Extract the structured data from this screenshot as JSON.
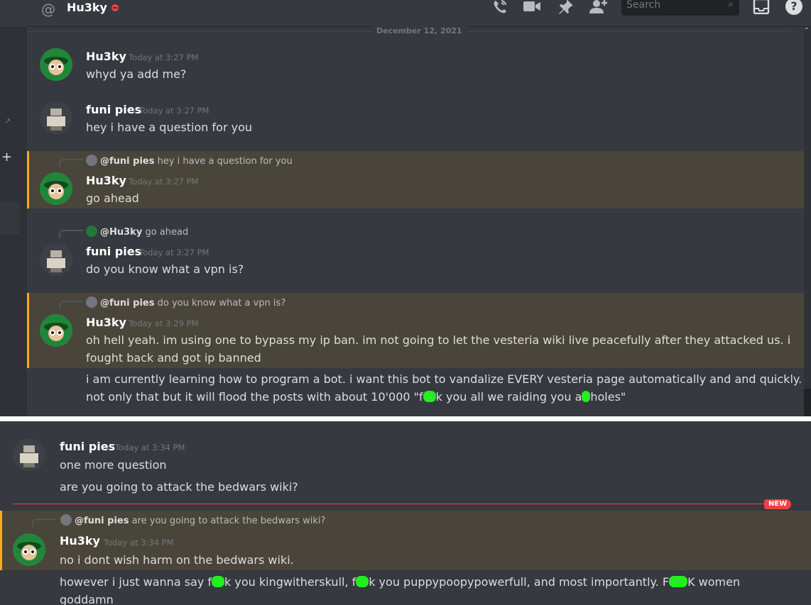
{
  "header": {
    "title": "Hu3ky",
    "search_placeholder": "Search"
  },
  "date_divider": "December 12, 2021",
  "messages": [
    {
      "author": "Hu3ky",
      "time": "Today at 3:27 PM",
      "text": "whyd ya add me?"
    },
    {
      "author": "funi pies",
      "time": "Today at 3:27 PM",
      "text": "hey i have a question for you"
    },
    {
      "reply_to": "@funi pies",
      "reply_text": "hey i have a question for you",
      "author": "Hu3ky",
      "time": "Today at 3:27 PM",
      "text": "go ahead"
    },
    {
      "reply_to": "@Hu3ky",
      "reply_text": "go ahead",
      "author": "funi pies",
      "time": "Today at 3:27 PM",
      "text": "do you know what a vpn is?"
    },
    {
      "reply_to": "@funi pies",
      "reply_text": "do you know what a vpn is?",
      "author": "Hu3ky",
      "time": "Today at 3:29 PM",
      "text_line1": "oh hell yeah. im using one to bypass my ip ban. im not going to let the vesteria wiki live peacefully after they attacked us. i",
      "text_line2": "fought back and got ip banned"
    },
    {
      "text_line1": "i am currently learning how to program a bot. i want this bot to vandalize EVERY vesteria page automatically and and quickly.",
      "text_line2_a": "not only that but it will flood the posts with about 10'000 \"f",
      "text_line2_b": "k you all we raiding you a",
      "text_line2_c": "holes\""
    }
  ],
  "bottom": {
    "msg1": {
      "author": "funi pies",
      "time": "Today at 3:34 PM",
      "text1": "one more question",
      "text2": "are you going to attack the bedwars wiki?"
    },
    "new_label": "NEW",
    "msg2": {
      "reply_to": "@funi pies",
      "reply_text": "are you going to attack the bedwars wiki?",
      "author": "Hu3ky",
      "time": "Today at 3:34 PM",
      "text": "no i dont wish harm on the bedwars wiki."
    },
    "msg3": {
      "t_a": "however i just wanna say f",
      "t_b": "k you kingwitherskull, f",
      "t_c": "k you puppypoopypowerfull, and most importantly. F",
      "t_d": "K women",
      "t_line2": "goddamn"
    }
  }
}
